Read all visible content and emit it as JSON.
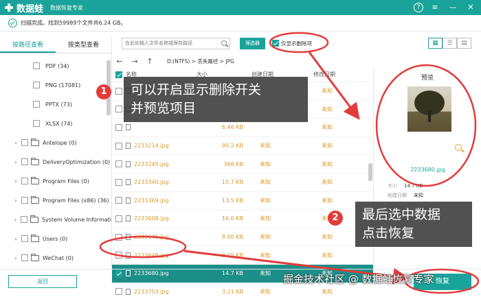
{
  "app": {
    "name": "数据蛙",
    "subtitle": "数据恢复专家"
  },
  "status": {
    "text": "扫描完成。找到59989个文件共6.24 GB。"
  },
  "left_tabs": [
    "按路径查看",
    "按类型查看"
  ],
  "tree": [
    {
      "label": "PDF (34)",
      "indent": 2
    },
    {
      "label": "PNG (17081)",
      "indent": 2
    },
    {
      "label": "PPTX (73)",
      "indent": 2
    },
    {
      "label": "XLSX (74)",
      "indent": 2
    },
    {
      "label": "Antelope (0)",
      "indent": 1
    },
    {
      "label": "DeliveryOptimization (0)",
      "indent": 1
    },
    {
      "label": "Program Files (0)",
      "indent": 1
    },
    {
      "label": "Program Files (x86) (36)",
      "indent": 1
    },
    {
      "label": "System Volume Informati",
      "indent": 1
    },
    {
      "label": "Users (0)",
      "indent": 1
    },
    {
      "label": "WeChat (0)",
      "indent": 1
    }
  ],
  "toolbar": {
    "search_placeholder": "在此处输入文件名称或保存路径",
    "filter_label": "筛选器",
    "show_deleted_label": "仅显示删除项"
  },
  "nav": {
    "path": "D:(NTFS) > 丢失路径 > JPG"
  },
  "columns": [
    "名称",
    "大小",
    "创建日期",
    "修改日期"
  ],
  "files": [
    {
      "name": "",
      "size": "",
      "ctime": "",
      "mtime": "未知"
    },
    {
      "name": "",
      "size": "",
      "ctime": "",
      "mtime": "未知"
    },
    {
      "name": "",
      "size": "6.46 KB",
      "ctime": "",
      "mtime": "未知"
    },
    {
      "name": "2233214.jpg",
      "size": "99.2 KB",
      "ctime": "未知",
      "mtime": "未知"
    },
    {
      "name": "2233245.jpg",
      "size": "366 KB",
      "ctime": "未知",
      "mtime": "未知"
    },
    {
      "name": "2233340.jpg",
      "size": "15.7 KB",
      "ctime": "未知",
      "mtime": "未知"
    },
    {
      "name": "2233369.jpg",
      "size": "13.5 KB",
      "ctime": "未知",
      "mtime": "未知"
    },
    {
      "name": "2233608.jpg",
      "size": "16.6 KB",
      "ctime": "未知",
      "mtime": "未知"
    },
    {
      "name": "2233646.jpg",
      "size": "8.00 KB",
      "ctime": "未知",
      "mtime": "未知"
    },
    {
      "name": "2233648.jpg",
      "size": "8.15 KB",
      "ctime": "未知",
      "mtime": "未知"
    },
    {
      "name": "2233680.jpg",
      "size": "14.7 KB",
      "ctime": "未知",
      "mtime": "未知",
      "selected": true
    },
    {
      "name": "2233753.jpg",
      "size": "3.21 KB",
      "ctime": "未知",
      "mtime": "未知"
    }
  ],
  "preview": {
    "title": "预览",
    "filename": "2233680.jpg",
    "size_label": "大小",
    "size": "14.7 KB",
    "ctime_label": "创建日期",
    "ctime": "未知"
  },
  "footer": {
    "back_label": "返回",
    "recover_label": "恢复"
  },
  "callouts": {
    "badge1": "1",
    "text1a": "可以开启显示删除开关",
    "text1b": "并预览项目",
    "badge2": "2",
    "text2a": "最后选中数据",
    "text2b": "点击恢复"
  },
  "watermark": "掘金技术社区 @ 数据蛙恢复专家",
  "colors": {
    "brand": "#1aa39a",
    "annotation": "#e23b3b",
    "file_text": "#d79a2c"
  }
}
